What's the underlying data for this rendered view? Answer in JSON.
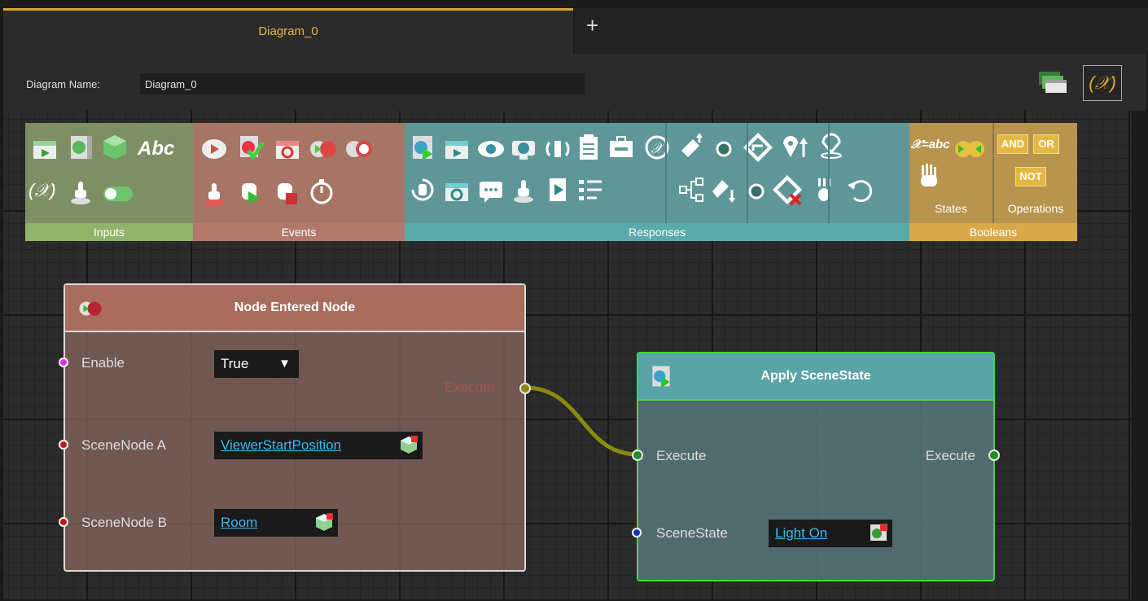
{
  "tabs": {
    "active_label": "Diagram_0",
    "add_label": "+"
  },
  "header": {
    "name_label": "Diagram Name:",
    "name_value": "Diagram_0",
    "variables_icon_text": "(𝒳)"
  },
  "palette": {
    "inputs_label": "Inputs",
    "events_label": "Events",
    "responses_label": "Responses",
    "booleans_label": "Booleans",
    "states_label": "States",
    "operations_label": "Operations",
    "abc_text": "Abc",
    "var_text": "(𝒳)",
    "xabc_text": "𝒳=abc",
    "and_text": "AND",
    "or_text": "OR",
    "not_text": "NOT"
  },
  "node_entered": {
    "title": "Node Entered Node",
    "enable_label": "Enable",
    "enable_value": "True",
    "scenenode_a_label": "SceneNode A",
    "scenenode_a_value": "ViewerStartPosition",
    "scenenode_b_label": "SceneNode B",
    "scenenode_b_value": "Room",
    "execute_out_label": "Execute"
  },
  "apply_scenestate": {
    "title": "Apply SceneState",
    "execute_in_label": "Execute",
    "execute_out_label": "Execute",
    "scenestate_label": "SceneState",
    "scenestate_value": "Light On"
  },
  "colors": {
    "inputs": "#8fb46a",
    "events": "#b2796b",
    "responses": "#5aaaab",
    "booleans": "#d9a84a",
    "accent": "#e6b84a",
    "selection_green": "#3ddc3d"
  }
}
